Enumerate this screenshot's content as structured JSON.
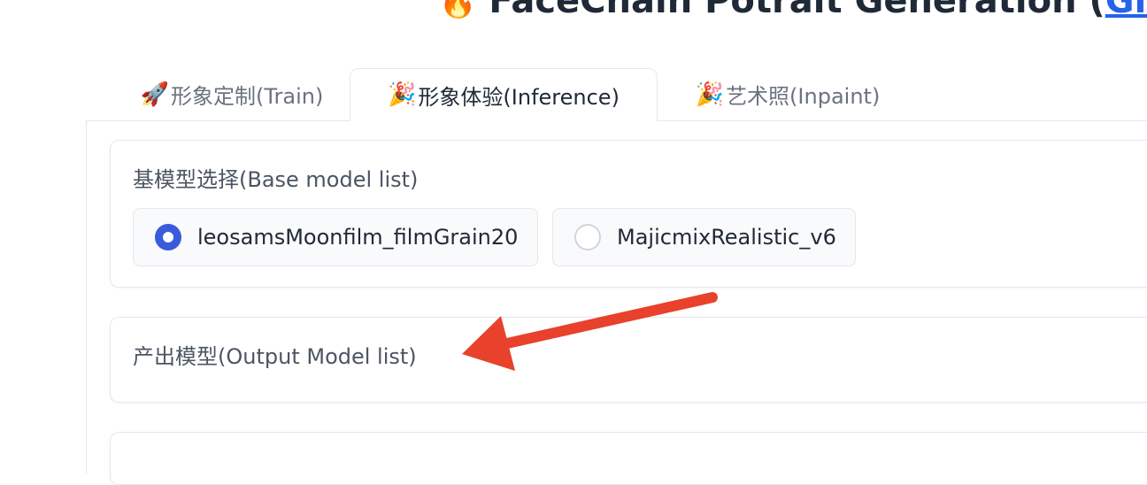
{
  "header": {
    "emoji": "🔥",
    "title": "FaceChain Potrait Generation (",
    "link_text": "Git"
  },
  "tabs": [
    {
      "icon": "🚀",
      "label": "形象定制(Train)",
      "active": false
    },
    {
      "icon": "🎉",
      "label": "形象体验(Inference)",
      "active": true
    },
    {
      "icon": "🎉",
      "label": "艺术照(Inpaint)",
      "active": false
    }
  ],
  "base_model": {
    "label": "基模型选择(Base model list)",
    "options": [
      {
        "label": "leosamsMoonfilm_filmGrain20",
        "selected": true
      },
      {
        "label": "MajicmixRealistic_v6",
        "selected": false
      }
    ]
  },
  "output_model": {
    "label": "产出模型(Output Model list)"
  },
  "third_block": {
    "label": ""
  },
  "colors": {
    "accent": "#3b5bdb",
    "annotation_arrow": "#e8412c",
    "link": "#2563eb"
  }
}
